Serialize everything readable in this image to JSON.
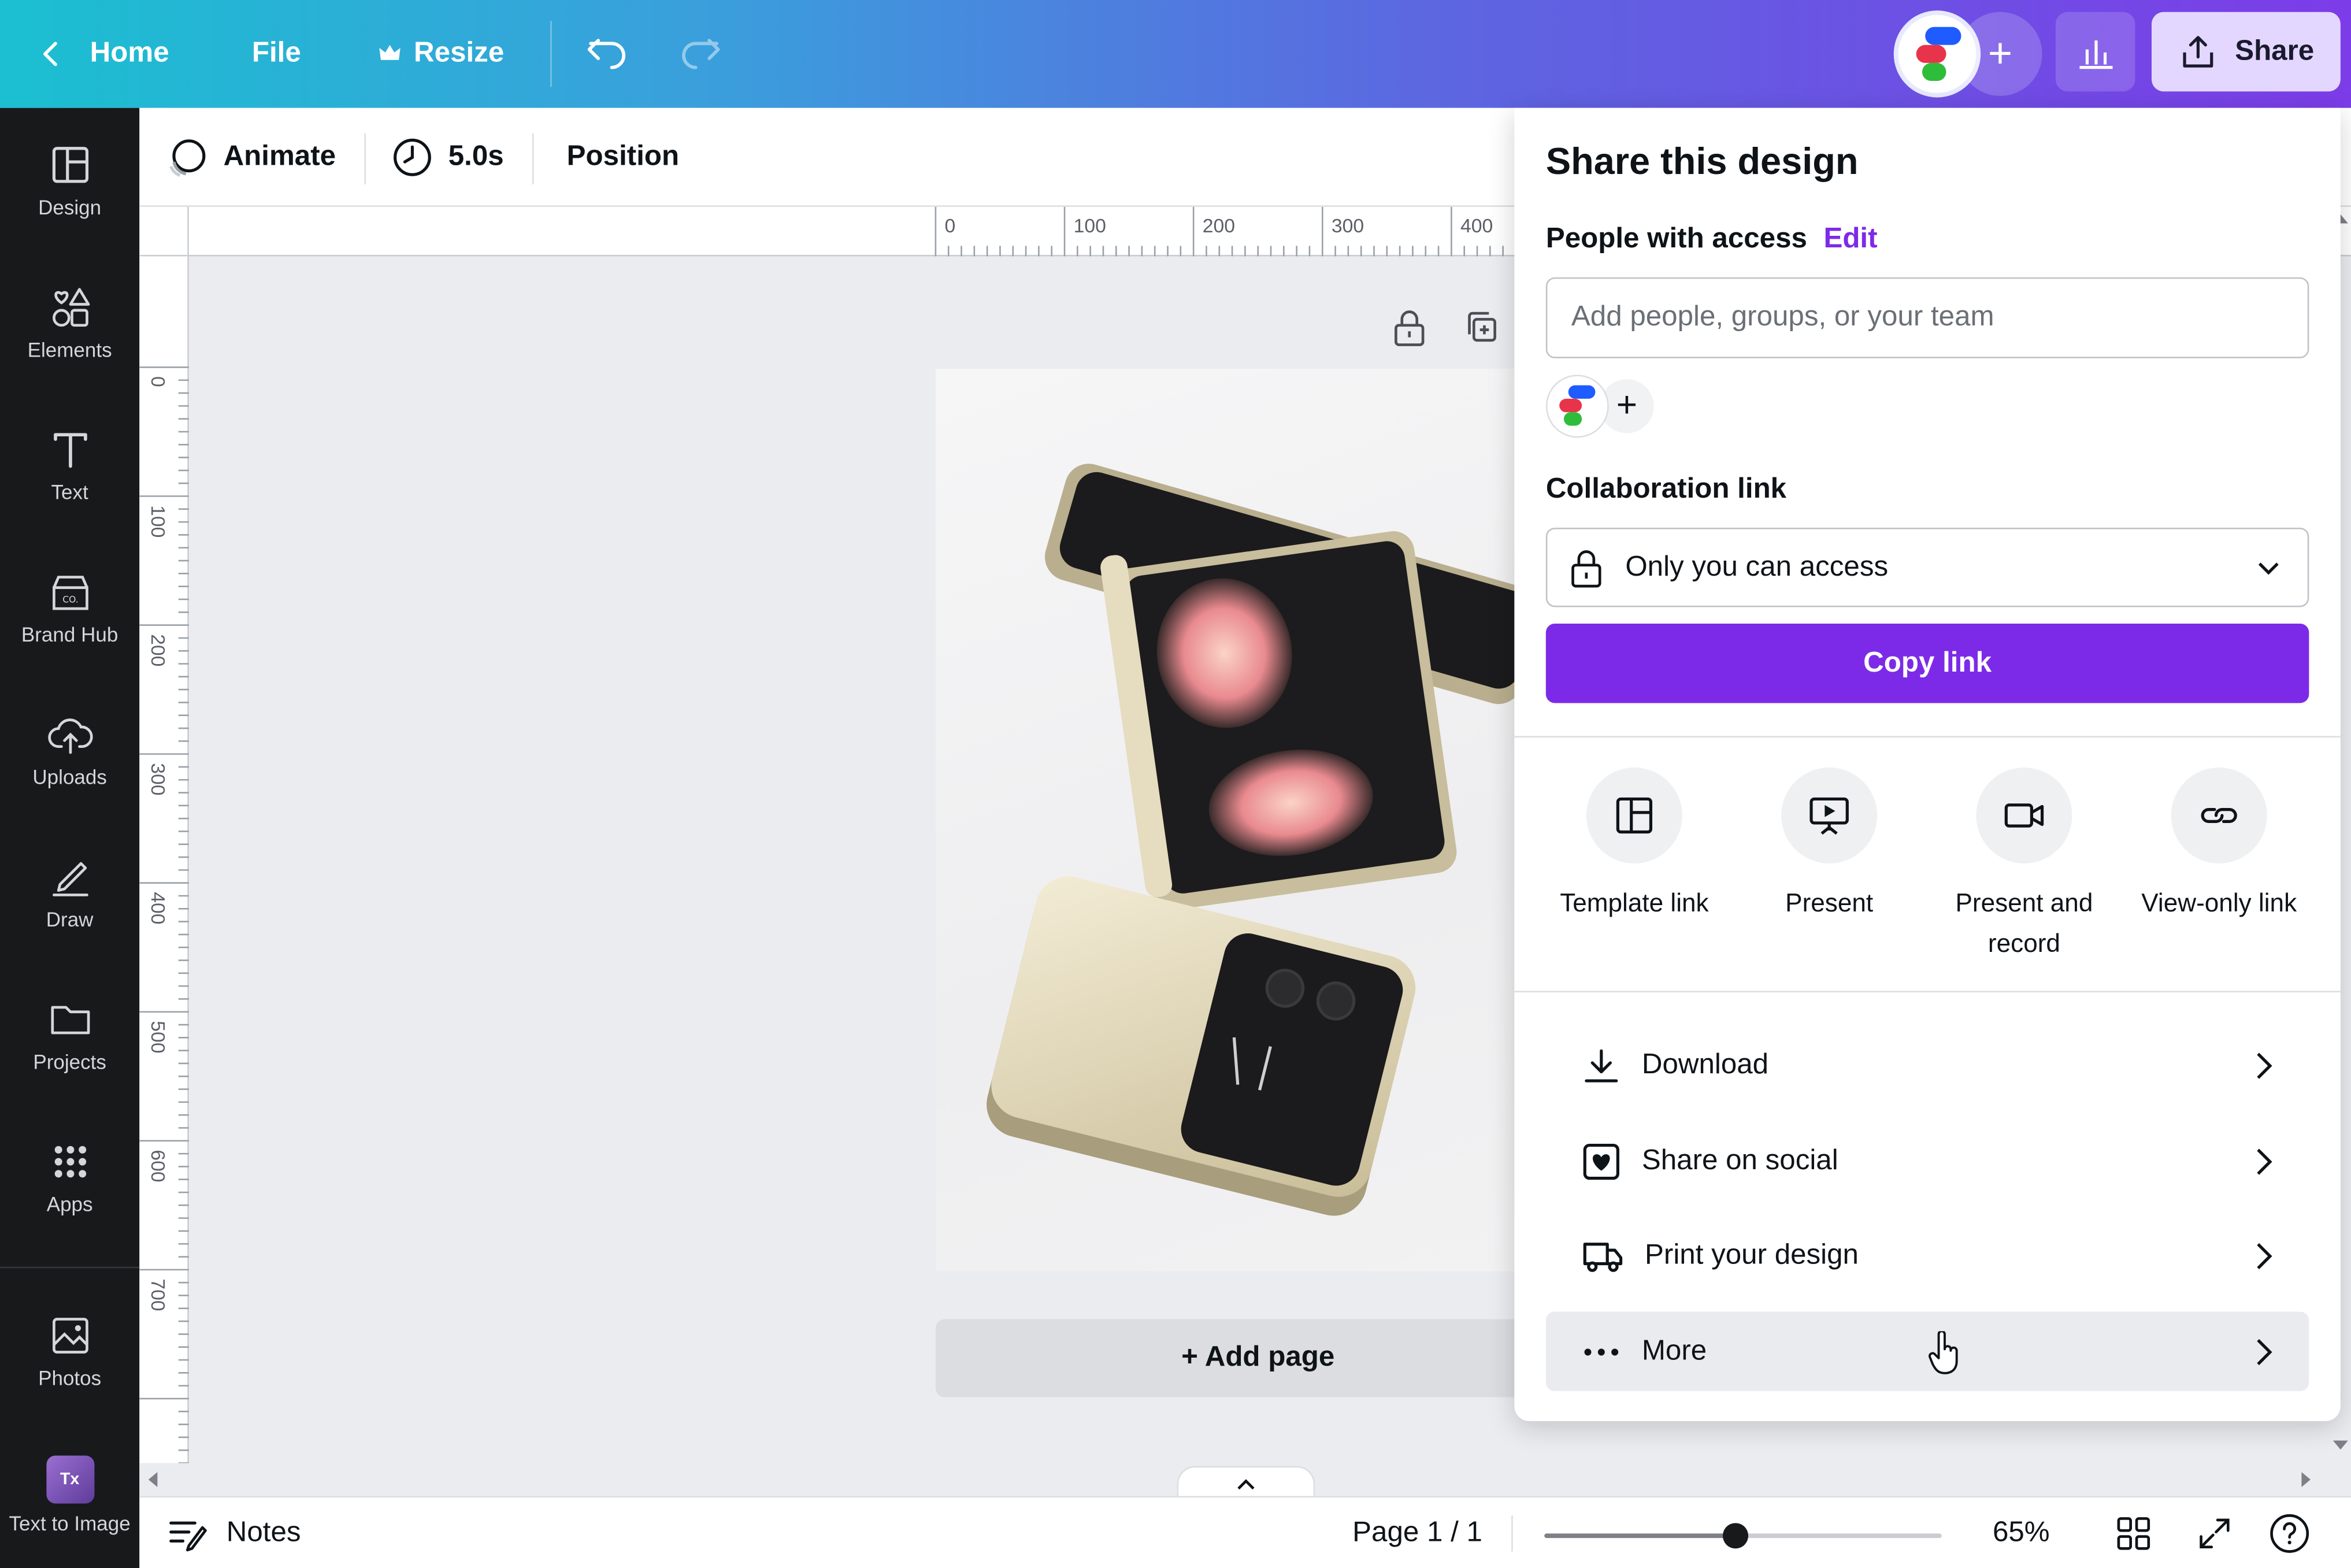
{
  "topbar": {
    "home_label": "Home",
    "file_label": "File",
    "resize_label": "Resize",
    "share_label": "Share",
    "accent_gradient": [
      "#1bbfd1",
      "#7c3ce8"
    ]
  },
  "sidebar": {
    "items": [
      {
        "label": "Design",
        "icon": "layout-icon"
      },
      {
        "label": "Elements",
        "icon": "shapes-icon"
      },
      {
        "label": "Text",
        "icon": "text-icon"
      },
      {
        "label": "Brand Hub",
        "icon": "brand-hub-icon"
      },
      {
        "label": "Uploads",
        "icon": "cloud-upload-icon"
      },
      {
        "label": "Draw",
        "icon": "pen-icon"
      },
      {
        "label": "Projects",
        "icon": "folder-icon"
      },
      {
        "label": "Apps",
        "icon": "apps-grid-icon"
      },
      {
        "label": "Photos",
        "icon": "image-icon"
      },
      {
        "label": "Text to Image",
        "icon": "text-to-image-icon"
      }
    ]
  },
  "toolbar": {
    "animate_label": "Animate",
    "duration_label": "5.0s",
    "position_label": "Position"
  },
  "ruler": {
    "top_ticks": [
      "0",
      "100",
      "200",
      "300",
      "400"
    ],
    "left_ticks": [
      "0",
      "100",
      "200",
      "300",
      "400",
      "500",
      "600",
      "700"
    ]
  },
  "canvas": {
    "add_page_label": "+ Add page",
    "image_subject": "foldable-phones-photo"
  },
  "bottombar": {
    "notes_label": "Notes",
    "page_label": "Page 1 / 1",
    "zoom_label": "65%",
    "zoom_value": 0.48
  },
  "share_panel": {
    "title": "Share this design",
    "people_label": "People with access",
    "edit_label": "Edit",
    "add_people_placeholder": "Add people, groups, or your team",
    "collab_label": "Collaboration link",
    "access_value": "Only you can access",
    "copy_link_label": "Copy link",
    "copy_color": "#7d2ae8",
    "options": [
      {
        "label": "Template link",
        "icon": "template-icon"
      },
      {
        "label": "Present",
        "icon": "present-icon"
      },
      {
        "label": "Present and record",
        "icon": "camera-icon"
      },
      {
        "label": "View-only link",
        "icon": "link-icon"
      }
    ],
    "rows": [
      {
        "label": "Download",
        "icon": "download-icon"
      },
      {
        "label": "Share on social",
        "icon": "heart-icon"
      },
      {
        "label": "Print your design",
        "icon": "truck-icon"
      },
      {
        "label": "More",
        "icon": "more-icon"
      }
    ]
  }
}
